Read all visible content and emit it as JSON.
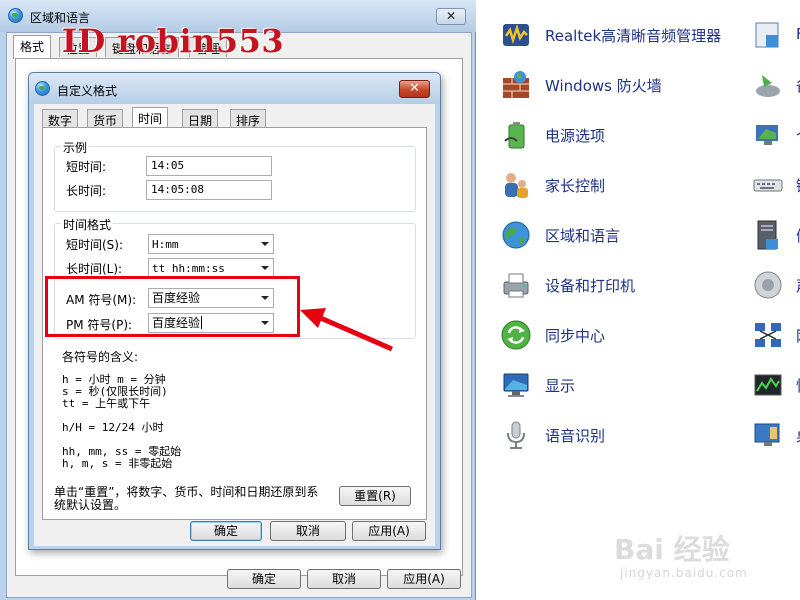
{
  "outer": {
    "title": "区域和语言",
    "close": "✕",
    "tabs": [
      "格式",
      "位置",
      "键盘和语言",
      "管理"
    ],
    "buttons": {
      "ok": "确定",
      "cancel": "取消",
      "apply": "应用(A)"
    }
  },
  "watermark": "ID robin553",
  "inner": {
    "title": "自定义格式",
    "close": "✕",
    "tabs": [
      "数字",
      "货币",
      "时间",
      "日期",
      "排序"
    ],
    "example": {
      "label": "示例",
      "short_label": "短时间:",
      "short_value": "14:05",
      "long_label": "长时间:",
      "long_value": "14:05:08"
    },
    "formats": {
      "label": "时间格式",
      "short_label": "短时间(S):",
      "short_value": "H:mm",
      "long_label": "长时间(L):",
      "long_value": "tt hh:mm:ss",
      "am_label": "AM 符号(M):",
      "am_value": "百度经验",
      "pm_label": "PM 符号(P):",
      "pm_value": "百度经验"
    },
    "meaning": {
      "title": "各符号的含义:",
      "line1": "h = 小时   m = 分钟",
      "line2": "s = 秒(仅限长时间)",
      "line3": "tt = 上午或下午",
      "line4": "h/H = 12/24 小时",
      "line5": "hh, mm, ss = 零起始",
      "line6": "h, m, s = 非零起始"
    },
    "reset_note_1": "单击“重置”，将数字、货币、时间和日期还原到系",
    "reset_note_2": "统默认设置。",
    "reset_button": "重置(R)",
    "buttons": {
      "ok": "确定",
      "cancel": "取消",
      "apply": "应用(A)"
    }
  },
  "control_panel": {
    "items": [
      {
        "label": "Realtek高清晰音频管理器",
        "icon": "audio-manager-icon"
      },
      {
        "label": "Windows 防火墙",
        "icon": "firewall-icon"
      },
      {
        "label": "电源选项",
        "icon": "power-options-icon"
      },
      {
        "label": "家长控制",
        "icon": "parental-controls-icon"
      },
      {
        "label": "区域和语言",
        "icon": "region-language-icon"
      },
      {
        "label": "设备和打印机",
        "icon": "devices-printers-icon"
      },
      {
        "label": "同步中心",
        "icon": "sync-center-icon"
      },
      {
        "label": "显示",
        "icon": "display-icon"
      },
      {
        "label": "语音识别",
        "icon": "speech-recognition-icon"
      }
    ],
    "right_items": [
      {
        "label": "F",
        "icon": "programs-icon"
      },
      {
        "label": "备",
        "icon": "backup-icon"
      },
      {
        "label": "个",
        "icon": "personalization-icon"
      },
      {
        "label": "键",
        "icon": "keyboard-icon"
      },
      {
        "label": "们",
        "icon": "performance-icon"
      },
      {
        "label": "声",
        "icon": "sound-icon"
      },
      {
        "label": "网",
        "icon": "network-icon"
      },
      {
        "label": "性",
        "icon": "performance-monitor-icon"
      },
      {
        "label": "桌",
        "icon": "desktop-gadgets-icon"
      }
    ]
  },
  "baidu": {
    "mark": "Bai 经验",
    "sub": "jingyan.baidu.com"
  }
}
